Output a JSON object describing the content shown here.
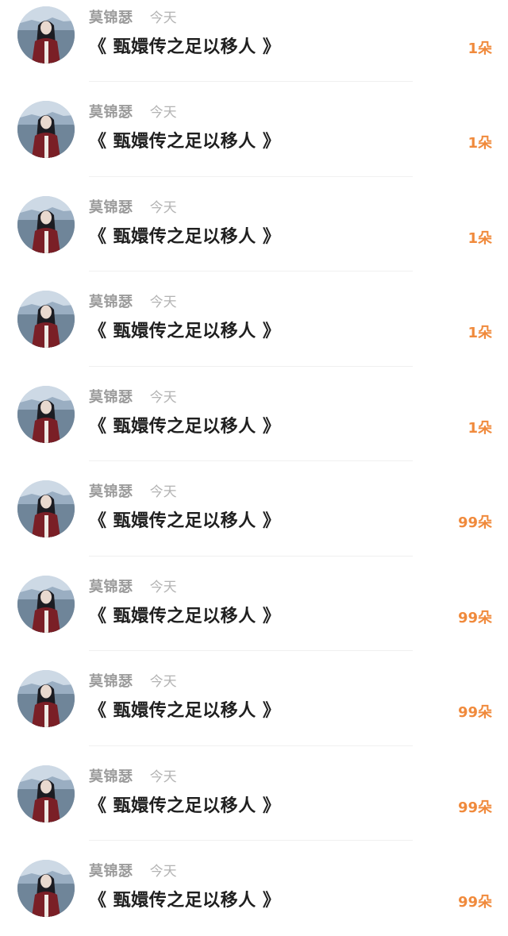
{
  "items": [
    {
      "name": "莫锦瑟",
      "time": "今天",
      "title": "《 甄嬛传之足以移人 》",
      "gift": "1朵"
    },
    {
      "name": "莫锦瑟",
      "time": "今天",
      "title": "《 甄嬛传之足以移人 》",
      "gift": "1朵"
    },
    {
      "name": "莫锦瑟",
      "time": "今天",
      "title": "《 甄嬛传之足以移人 》",
      "gift": "1朵"
    },
    {
      "name": "莫锦瑟",
      "time": "今天",
      "title": "《 甄嬛传之足以移人 》",
      "gift": "1朵"
    },
    {
      "name": "莫锦瑟",
      "time": "今天",
      "title": "《 甄嬛传之足以移人 》",
      "gift": "1朵"
    },
    {
      "name": "莫锦瑟",
      "time": "今天",
      "title": "《 甄嬛传之足以移人 》",
      "gift": "99朵"
    },
    {
      "name": "莫锦瑟",
      "time": "今天",
      "title": "《 甄嬛传之足以移人 》",
      "gift": "99朵"
    },
    {
      "name": "莫锦瑟",
      "time": "今天",
      "title": "《 甄嬛传之足以移人 》",
      "gift": "99朵"
    },
    {
      "name": "莫锦瑟",
      "time": "今天",
      "title": "《 甄嬛传之足以移人 》",
      "gift": "99朵"
    },
    {
      "name": "莫锦瑟",
      "time": "今天",
      "title": "《 甄嬛传之足以移人 》",
      "gift": "99朵"
    }
  ],
  "colors": {
    "gift": "#f08a3c",
    "name": "#9b9b9b",
    "time": "#b3b3b3",
    "title": "#1f1f1f"
  },
  "icons": {
    "avatar": "user-avatar-photo"
  }
}
